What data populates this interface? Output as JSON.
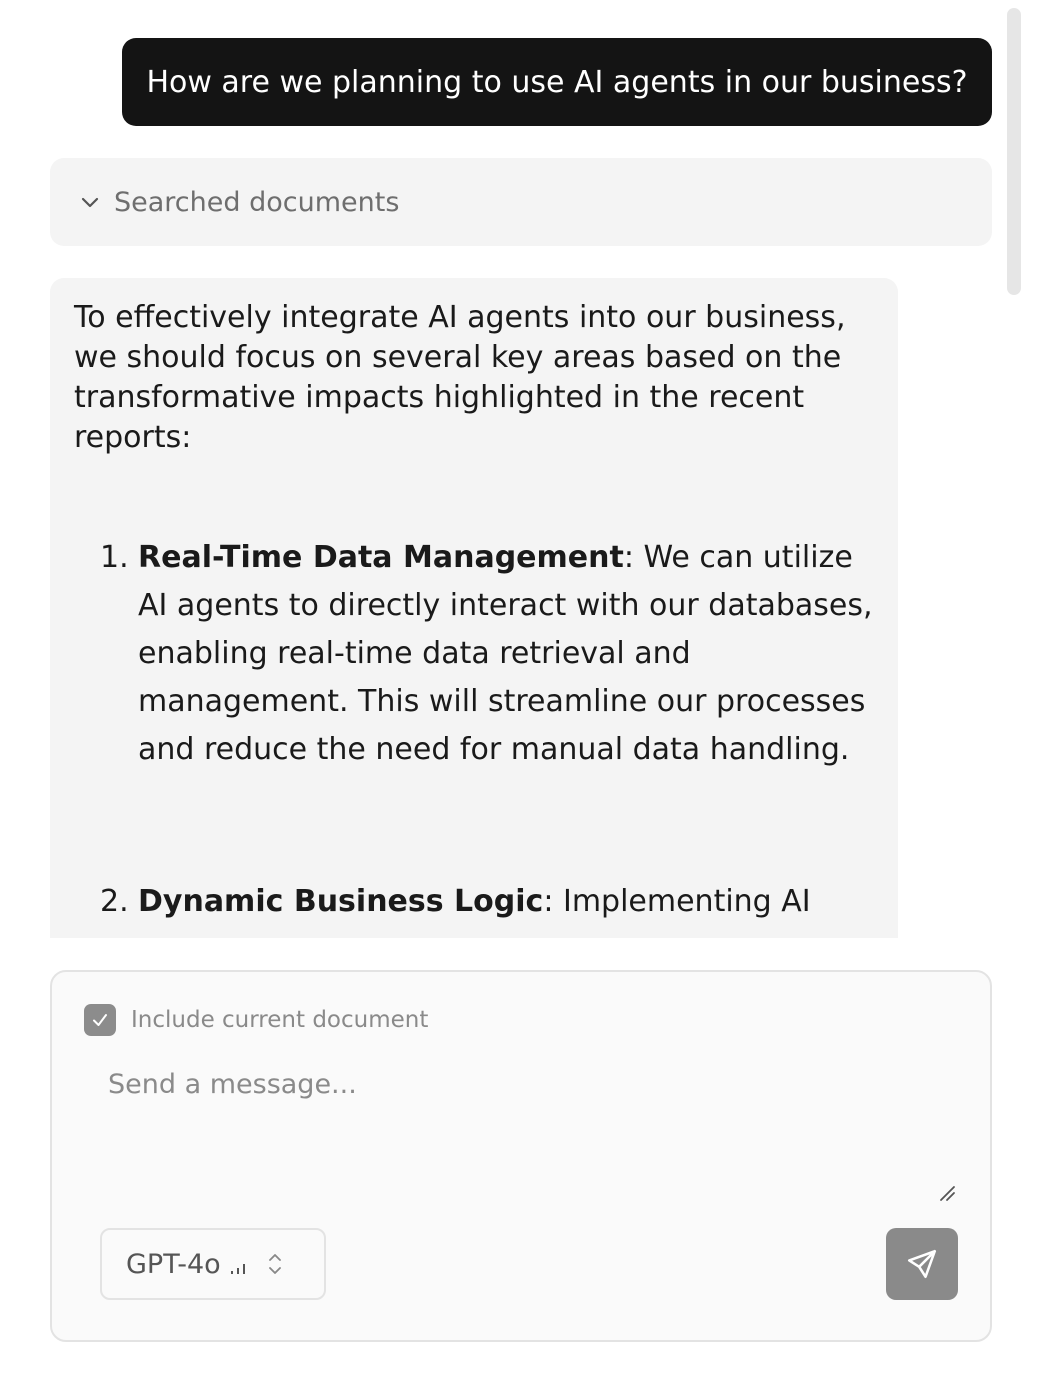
{
  "conversation": {
    "user_message": "How are we planning to use AI agents in our business?",
    "searched_label": "Searched documents",
    "answer": {
      "intro": "To effectively integrate AI agents into our business, we should focus on several key areas based on the transformative impacts highlighted in the recent reports:",
      "items": [
        {
          "number": "1.",
          "title": "Real-Time Data Management",
          "text": ": We can utilize AI agents to directly interact with our databases, enabling real-time data retrieval and management. This will streamline our processes and reduce the need for manual data handling."
        },
        {
          "number": "2.",
          "title": "Dynamic Business Logic",
          "text": ": Implementing AI"
        }
      ]
    }
  },
  "composer": {
    "include_label": "Include current document",
    "include_checked": true,
    "placeholder": "Send a message...",
    "model": "GPT-4o"
  },
  "icons": {
    "searched_toggle": "chevron-down-icon",
    "checkbox": "check-icon",
    "model_strength": "signal-bars-icon",
    "model_switch": "chevron-up-down-icon",
    "send": "paper-plane-icon"
  },
  "colors": {
    "user_bubble": "#141414",
    "assistant_bg": "#f4f4f4",
    "send_button": "#8a8a8a"
  }
}
